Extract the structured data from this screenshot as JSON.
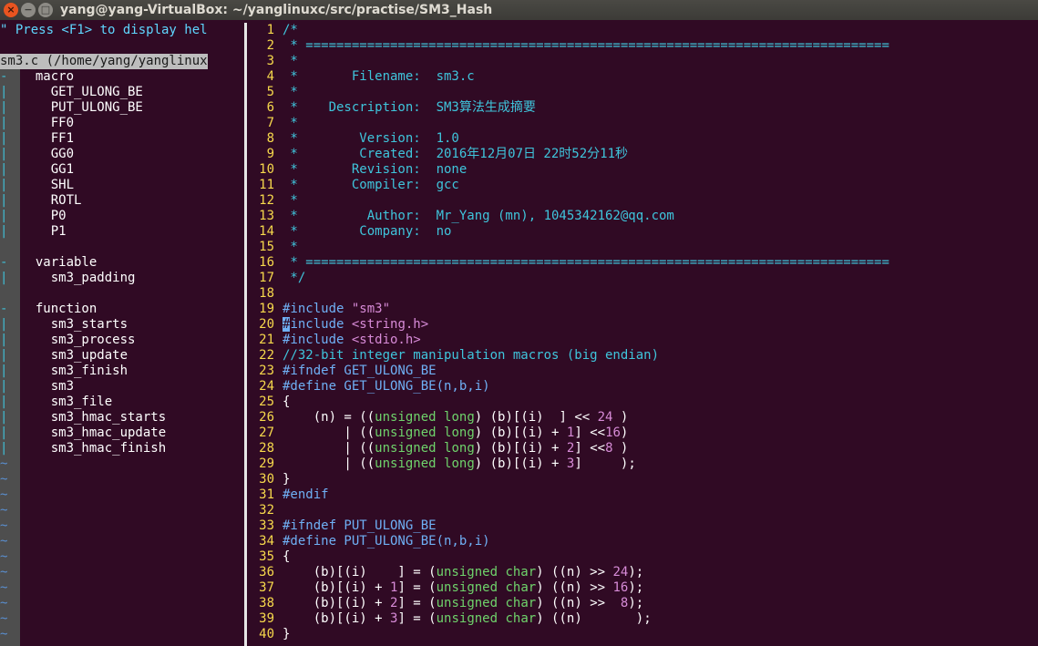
{
  "window": {
    "title": "yang@yang-VirtualBox: ~/yanglinuxc/src/practise/SM3_Hash",
    "close_glyph": "×",
    "min_glyph": "−",
    "max_glyph": "□"
  },
  "taglist": {
    "help": "\" Press <F1> to display hel",
    "file_line": "sm3.c (/home/yang/yanglinux",
    "groups": [
      {
        "label": "macro",
        "items": [
          "GET_ULONG_BE",
          "PUT_ULONG_BE",
          "FF0",
          "FF1",
          "GG0",
          "GG1",
          "SHL",
          "ROTL",
          "P0",
          "P1"
        ]
      },
      {
        "label": "variable",
        "items": [
          "sm3_padding"
        ]
      },
      {
        "label": "function",
        "items": [
          "sm3_starts",
          "sm3_process",
          "sm3_update",
          "sm3_finish",
          "sm3",
          "sm3_file",
          "sm3_hmac_starts",
          "sm3_hmac_update",
          "sm3_hmac_finish"
        ]
      }
    ],
    "fold_open": "-",
    "fold_bar": "|",
    "tilde": "~"
  },
  "editor": {
    "lines": [
      {
        "n": "1",
        "s": [
          [
            "c",
            "/*"
          ]
        ]
      },
      {
        "n": "2",
        "s": [
          [
            "c",
            " * ============================================================================"
          ]
        ]
      },
      {
        "n": "3",
        "s": [
          [
            "c",
            " *"
          ]
        ]
      },
      {
        "n": "4",
        "s": [
          [
            "c",
            " *       Filename:  sm3.c"
          ]
        ]
      },
      {
        "n": "5",
        "s": [
          [
            "c",
            " *"
          ]
        ]
      },
      {
        "n": "6",
        "s": [
          [
            "c",
            " *    Description:  SM3算法生成摘要"
          ]
        ]
      },
      {
        "n": "7",
        "s": [
          [
            "c",
            " *"
          ]
        ]
      },
      {
        "n": "8",
        "s": [
          [
            "c",
            " *        Version:  1.0"
          ]
        ]
      },
      {
        "n": "9",
        "s": [
          [
            "c",
            " *        Created:  2016年12月07日 22时52分11秒"
          ]
        ]
      },
      {
        "n": "10",
        "s": [
          [
            "c",
            " *       Revision:  none"
          ]
        ]
      },
      {
        "n": "11",
        "s": [
          [
            "c",
            " *       Compiler:  gcc"
          ]
        ]
      },
      {
        "n": "12",
        "s": [
          [
            "c",
            " *"
          ]
        ]
      },
      {
        "n": "13",
        "s": [
          [
            "c",
            " *         Author:  Mr_Yang (mn), 1045342162@qq.com"
          ]
        ]
      },
      {
        "n": "14",
        "s": [
          [
            "c",
            " *        Company:  no"
          ]
        ]
      },
      {
        "n": "15",
        "s": [
          [
            "c",
            " *"
          ]
        ]
      },
      {
        "n": "16",
        "s": [
          [
            "c",
            " * ============================================================================"
          ]
        ]
      },
      {
        "n": "17",
        "s": [
          [
            "c",
            " */"
          ]
        ]
      },
      {
        "n": "18",
        "s": []
      },
      {
        "n": "19",
        "s": [
          [
            "p",
            "#include "
          ],
          [
            "s",
            "\"sm3\""
          ]
        ]
      },
      {
        "n": "20",
        "s": [
          [
            "k",
            "#"
          ],
          [
            "p",
            "include "
          ],
          [
            "s",
            "<string.h>"
          ]
        ]
      },
      {
        "n": "21",
        "s": [
          [
            "p",
            "#include "
          ],
          [
            "s",
            "<stdio.h>"
          ]
        ]
      },
      {
        "n": "22",
        "s": [
          [
            "c",
            "//32-bit integer manipulation macros (big endian)"
          ]
        ]
      },
      {
        "n": "23",
        "s": [
          [
            "p",
            "#ifndef GET_ULONG_BE"
          ]
        ]
      },
      {
        "n": "24",
        "s": [
          [
            "p",
            "#define GET_ULONG_BE(n,b,i)"
          ]
        ]
      },
      {
        "n": "25",
        "s": [
          [
            "o",
            "{"
          ]
        ]
      },
      {
        "n": "26",
        "s": [
          [
            "o",
            "    (n) = (("
          ],
          [
            "t",
            "unsigned"
          ],
          [
            "o",
            " "
          ],
          [
            "t",
            "long"
          ],
          [
            "o",
            ") (b)[(i)  ] << "
          ],
          [
            "m",
            "24"
          ],
          [
            "o",
            " )"
          ]
        ]
      },
      {
        "n": "27",
        "s": [
          [
            "o",
            "        | (("
          ],
          [
            "t",
            "unsigned"
          ],
          [
            "o",
            " "
          ],
          [
            "t",
            "long"
          ],
          [
            "o",
            ") (b)[(i) + "
          ],
          [
            "m",
            "1"
          ],
          [
            "o",
            "] <<"
          ],
          [
            "m",
            "16"
          ],
          [
            "o",
            ")"
          ]
        ]
      },
      {
        "n": "28",
        "s": [
          [
            "o",
            "        | (("
          ],
          [
            "t",
            "unsigned"
          ],
          [
            "o",
            " "
          ],
          [
            "t",
            "long"
          ],
          [
            "o",
            ") (b)[(i) + "
          ],
          [
            "m",
            "2"
          ],
          [
            "o",
            "] <<"
          ],
          [
            "m",
            "8"
          ],
          [
            "o",
            " )"
          ]
        ]
      },
      {
        "n": "29",
        "s": [
          [
            "o",
            "        | (("
          ],
          [
            "t",
            "unsigned"
          ],
          [
            "o",
            " "
          ],
          [
            "t",
            "long"
          ],
          [
            "o",
            ") (b)[(i) + "
          ],
          [
            "m",
            "3"
          ],
          [
            "o",
            "]     );"
          ]
        ]
      },
      {
        "n": "30",
        "s": [
          [
            "o",
            "}"
          ]
        ]
      },
      {
        "n": "31",
        "s": [
          [
            "p",
            "#endif"
          ]
        ]
      },
      {
        "n": "32",
        "s": []
      },
      {
        "n": "33",
        "s": [
          [
            "p",
            "#ifndef PUT_ULONG_BE"
          ]
        ]
      },
      {
        "n": "34",
        "s": [
          [
            "p",
            "#define PUT_ULONG_BE(n,b,i)"
          ]
        ]
      },
      {
        "n": "35",
        "s": [
          [
            "o",
            "{"
          ]
        ]
      },
      {
        "n": "36",
        "s": [
          [
            "o",
            "    (b)[(i)    ] = ("
          ],
          [
            "t",
            "unsigned"
          ],
          [
            "o",
            " "
          ],
          [
            "t",
            "char"
          ],
          [
            "o",
            ") ((n) >> "
          ],
          [
            "m",
            "24"
          ],
          [
            "o",
            ");"
          ]
        ]
      },
      {
        "n": "37",
        "s": [
          [
            "o",
            "    (b)[(i) + "
          ],
          [
            "m",
            "1"
          ],
          [
            "o",
            "] = ("
          ],
          [
            "t",
            "unsigned"
          ],
          [
            "o",
            " "
          ],
          [
            "t",
            "char"
          ],
          [
            "o",
            ") ((n) >> "
          ],
          [
            "m",
            "16"
          ],
          [
            "o",
            ");"
          ]
        ]
      },
      {
        "n": "38",
        "s": [
          [
            "o",
            "    (b)[(i) + "
          ],
          [
            "m",
            "2"
          ],
          [
            "o",
            "] = ("
          ],
          [
            "t",
            "unsigned"
          ],
          [
            "o",
            " "
          ],
          [
            "t",
            "char"
          ],
          [
            "o",
            ") ((n) >>  "
          ],
          [
            "m",
            "8"
          ],
          [
            "o",
            ");"
          ]
        ]
      },
      {
        "n": "39",
        "s": [
          [
            "o",
            "    (b)[(i) + "
          ],
          [
            "m",
            "3"
          ],
          [
            "o",
            "] = ("
          ],
          [
            "t",
            "unsigned"
          ],
          [
            "o",
            " "
          ],
          [
            "t",
            "char"
          ],
          [
            "o",
            ") ((n)       );"
          ]
        ]
      },
      {
        "n": "40",
        "s": [
          [
            "o",
            "}"
          ]
        ]
      }
    ]
  }
}
